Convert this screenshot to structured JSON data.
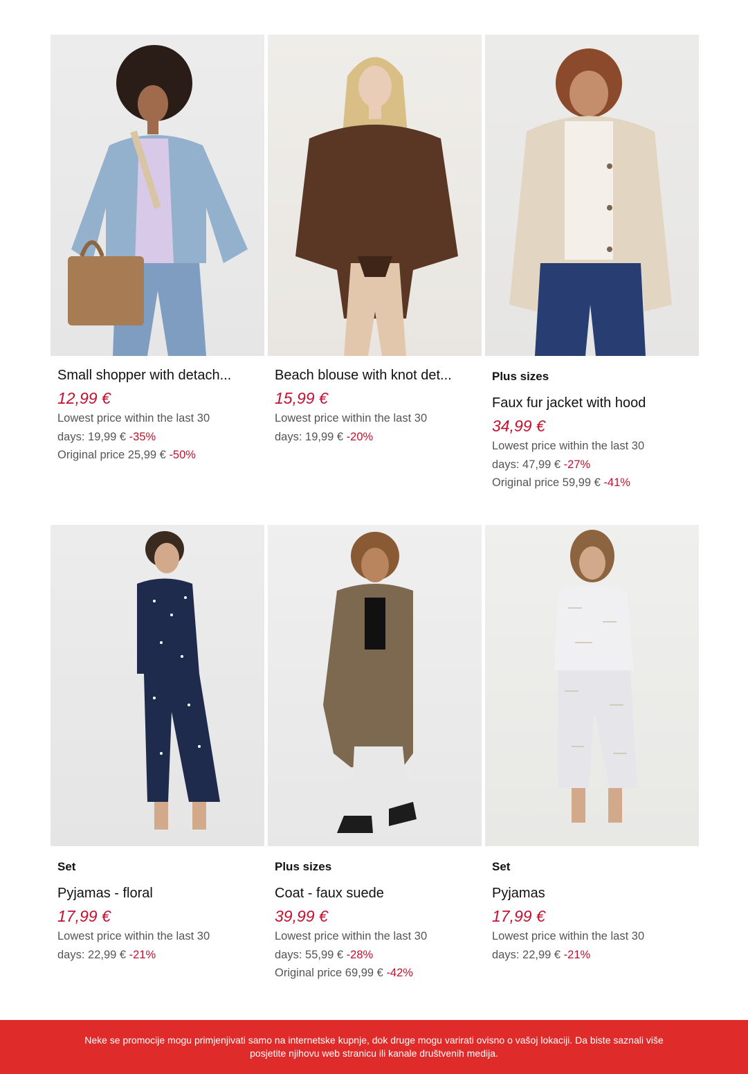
{
  "products": [
    {
      "tag": "",
      "title": "Small shopper with detach...",
      "price": "12,99 €",
      "lowest_line1": "Lowest price within the last 30",
      "lowest_line2_prefix": "days: 19,99 €",
      "lowest_discount": "-35%",
      "original_prefix": "Original price 25,99 €",
      "original_discount": "-50%"
    },
    {
      "tag": "",
      "title": "Beach blouse with knot det...",
      "price": "15,99 €",
      "lowest_line1": "Lowest price within the last 30",
      "lowest_line2_prefix": "days: 19,99 €",
      "lowest_discount": "-20%",
      "original_prefix": "",
      "original_discount": ""
    },
    {
      "tag": "Plus sizes",
      "title": "Faux fur jacket with hood",
      "price": "34,99 €",
      "lowest_line1": "Lowest price within the last 30",
      "lowest_line2_prefix": "days: 47,99 €",
      "lowest_discount": "-27%",
      "original_prefix": "Original price 59,99 €",
      "original_discount": "-41%"
    },
    {
      "tag": "Set",
      "title": "Pyjamas - floral",
      "price": "17,99 €",
      "lowest_line1": "Lowest price within the last 30",
      "lowest_line2_prefix": "days: 22,99 €",
      "lowest_discount": "-21%",
      "original_prefix": "",
      "original_discount": ""
    },
    {
      "tag": "Plus sizes",
      "title": "Coat - faux suede",
      "price": "39,99 €",
      "lowest_line1": "Lowest price within the last 30",
      "lowest_line2_prefix": "days: 55,99 €",
      "lowest_discount": "-28%",
      "original_prefix": "Original price 69,99 €",
      "original_discount": "-42%"
    },
    {
      "tag": "Set",
      "title": "Pyjamas",
      "price": "17,99 €",
      "lowest_line1": "Lowest price within the last 30",
      "lowest_line2_prefix": "days: 22,99 €",
      "lowest_discount": "-21%",
      "original_prefix": "",
      "original_discount": ""
    }
  ],
  "footer": {
    "line1": "Neke se promocije mogu primjenjivati samo na internetske kupnje, dok druge mogu varirati ovisno o vašoj lokaciji. Da biste saznali više",
    "line2": "posjetite njihovu web stranicu ili kanale društvenih medija."
  },
  "colors": {
    "price_red": "#c3102f",
    "footer_red": "#e02b2b",
    "image_bg": "#eeeeec"
  }
}
